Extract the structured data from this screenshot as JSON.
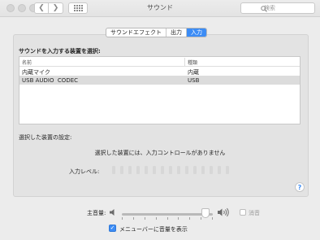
{
  "window": {
    "title": "サウンド"
  },
  "search": {
    "placeholder": "検索"
  },
  "tabs": [
    {
      "label": "サウンドエフェクト",
      "active": false
    },
    {
      "label": "出力",
      "active": false
    },
    {
      "label": "入力",
      "active": true
    }
  ],
  "input": {
    "select_label": "サウンドを入力する装置を選択:",
    "columns": {
      "name": "名前",
      "type": "種類"
    },
    "devices": [
      {
        "name": "内蔵マイク",
        "type": "内蔵",
        "selected": false
      },
      {
        "name": "USB AUDIO  CODEC",
        "type": "USB",
        "selected": true
      }
    ],
    "settings_label": "選択した装置の設定:",
    "no_controls_text": "選択した装置には、入力コントロールがありません",
    "level_label": "入力レベル:",
    "level_segments": 15
  },
  "help": {
    "label": "?"
  },
  "volume": {
    "label": "主音量:",
    "level_percent": 92,
    "mute_label": "消音",
    "muted": false
  },
  "menubar": {
    "label": "メニューバーに音量を表示",
    "checked": true
  },
  "colors": {
    "accent": "#3c8cf5"
  }
}
